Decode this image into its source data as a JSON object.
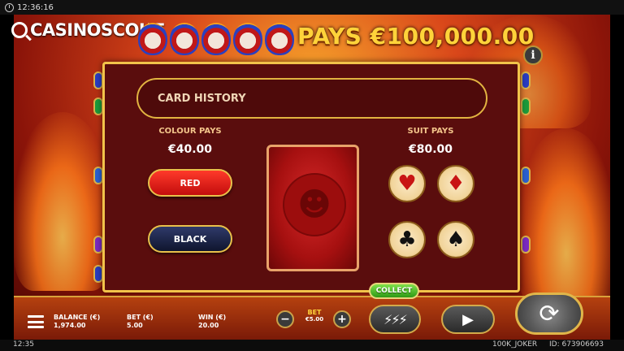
{
  "status_bar": {
    "time": "12:36:16"
  },
  "branding": {
    "logo_text": "CASINOSCOUT"
  },
  "header": {
    "jackpot_text": "PAYS €100,000.00",
    "info_label": "i"
  },
  "gamble": {
    "history_label": "CARD HISTORY",
    "colour_pays_label": "COLOUR PAYS",
    "colour_pays_amount": "€40.00",
    "suit_pays_label": "SUIT PAYS",
    "suit_pays_amount": "€80.00",
    "red_label": "RED",
    "black_label": "BLACK",
    "suits": {
      "hearts": "♥",
      "diamonds": "♦",
      "clubs": "♣",
      "spades": "♠"
    },
    "card_emblem": "☻"
  },
  "collect_label": "COLLECT",
  "controls": {
    "balance_label": "BALANCE (€)",
    "balance_value": "1,974.00",
    "bet_label": "BET (€)",
    "bet_value": "5.00",
    "win_label": "WIN (€)",
    "win_value": "20.00",
    "bet_selector_label": "BET",
    "bet_selector_value": "€5.00",
    "minus": "−",
    "plus": "+",
    "turbo_icon": "⚡⚡⚡",
    "play_icon": "▶",
    "spin_icon": "⟳"
  },
  "footer": {
    "time": "12:35",
    "game_name": "100K_JOKER",
    "game_id": "ID: 673906693"
  },
  "colors": {
    "panel": "#5a0d0d",
    "gold": "#f2c34a",
    "red_button": "#e11d1d",
    "black_button": "#1a2245",
    "collect": "#4cbb22"
  }
}
